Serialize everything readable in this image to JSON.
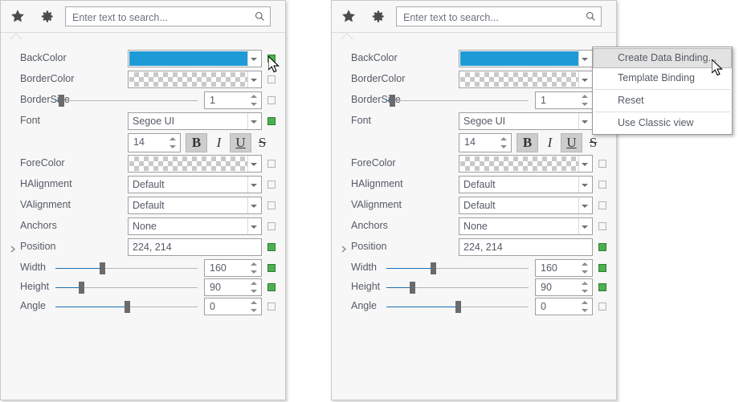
{
  "header": {
    "star_icon": "star-icon",
    "gear_icon": "gear-icon",
    "search_placeholder": "Enter text to search...",
    "search_value": "",
    "search_icon": "search-icon"
  },
  "colors": {
    "backcolor_swatch": "#1e9bd7",
    "binding_marker_bound": "#4caf50",
    "binding_marker_border": "#2e7d32",
    "slider_fill": "#1a6fb5",
    "slider_track": "#b5b5b5",
    "slider_thumb": "#6b6b6b",
    "panel_background": "#f7f7f7",
    "menu_highlight": "#e2e2e2"
  },
  "properties": [
    {
      "name": "BackColor",
      "label": "BackColor",
      "editor": "color",
      "value": "",
      "swatch": "solid",
      "bound": true,
      "expandable": false
    },
    {
      "name": "BorderColor",
      "label": "BorderColor",
      "editor": "color",
      "value": "",
      "swatch": "transparent",
      "bound": false,
      "expandable": false
    },
    {
      "name": "BorderSize",
      "label": "BorderSize",
      "editor": "slider",
      "value": "1",
      "slider_percent": 4,
      "bound": false,
      "expandable": false
    },
    {
      "name": "Font",
      "label": "Font",
      "editor": "combo",
      "value": "Segoe UI",
      "bound": true,
      "expandable": false
    },
    {
      "name": "FontSize",
      "label": "",
      "editor": "fontbar",
      "value": "14",
      "bound": null,
      "expandable": false
    },
    {
      "name": "ForeColor",
      "label": "ForeColor",
      "editor": "color",
      "value": "",
      "swatch": "transparent",
      "bound": false,
      "expandable": false
    },
    {
      "name": "HAlignment",
      "label": "HAlignment",
      "editor": "combo",
      "value": "Default",
      "bound": false,
      "expandable": false
    },
    {
      "name": "VAlignment",
      "label": "VAlignment",
      "editor": "combo",
      "value": "Default",
      "bound": false,
      "expandable": false
    },
    {
      "name": "Anchors",
      "label": "Anchors",
      "editor": "combo",
      "value": "None",
      "bound": false,
      "expandable": false
    },
    {
      "name": "Position",
      "label": "Position",
      "editor": "text",
      "value": "224, 214",
      "bound": true,
      "expandable": true
    },
    {
      "name": "Width",
      "label": "Width",
      "editor": "slider",
      "value": "160",
      "slider_percent": 33,
      "bound": true,
      "expandable": false
    },
    {
      "name": "Height",
      "label": "Height",
      "editor": "slider",
      "value": "90",
      "slider_percent": 18,
      "bound": true,
      "expandable": false
    },
    {
      "name": "Angle",
      "label": "Angle",
      "editor": "slider",
      "value": "0",
      "slider_percent": 50,
      "bound": false,
      "expandable": false
    }
  ],
  "font_toolbar": {
    "size_value": "14",
    "buttons": [
      {
        "name": "bold",
        "glyph": "B",
        "active": true
      },
      {
        "name": "italic",
        "glyph": "I",
        "active": false
      },
      {
        "name": "underline",
        "glyph": "U",
        "active": true
      },
      {
        "name": "strikethrough",
        "glyph": "S",
        "active": false
      }
    ]
  },
  "context_menu": {
    "items": [
      {
        "label": "Create Data Binding...",
        "highlighted": true,
        "separator_after": false
      },
      {
        "label": "Template Binding",
        "highlighted": false,
        "separator_after": true
      },
      {
        "label": "Reset",
        "highlighted": false,
        "separator_after": true
      },
      {
        "label": "Use Classic view",
        "highlighted": false,
        "separator_after": false
      }
    ]
  }
}
